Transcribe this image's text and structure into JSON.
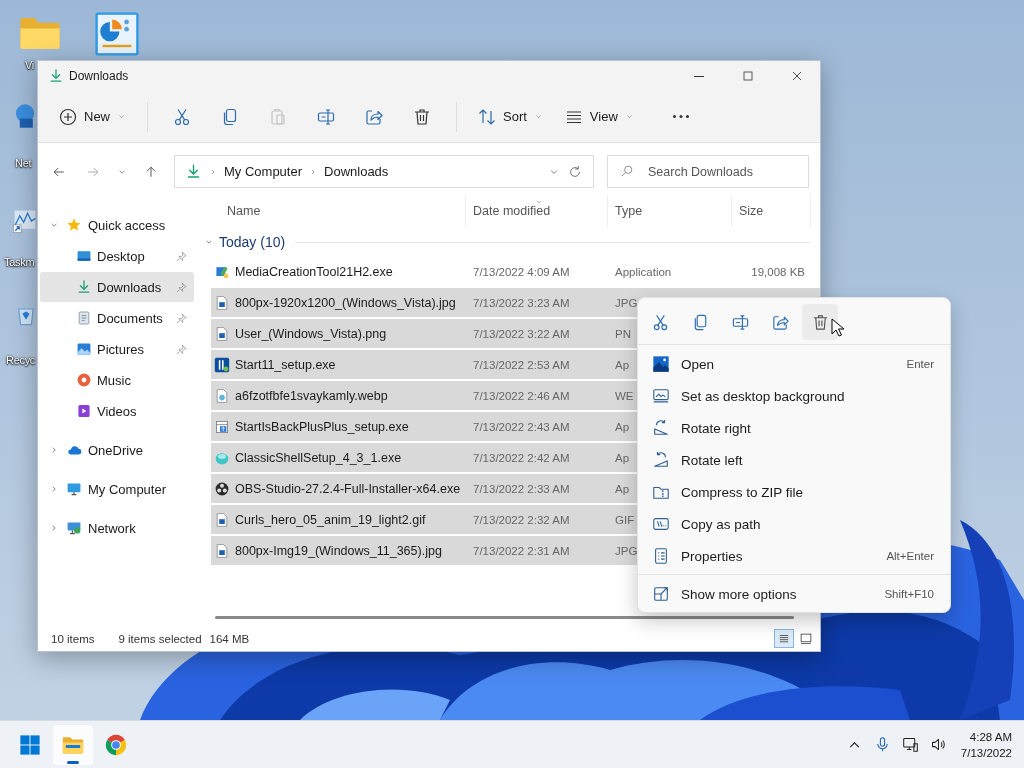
{
  "desktop_icons": [
    {
      "kind": "folder",
      "label": "Vi"
    },
    {
      "kind": "control-panel"
    },
    {
      "kind": "globe",
      "label": "Net"
    },
    {
      "kind": "task-manager",
      "label": "Taskm"
    },
    {
      "kind": "recycle-bin",
      "label": "Recyc"
    }
  ],
  "window": {
    "title": "Downloads"
  },
  "toolbar": [
    {
      "kind": "new",
      "label": "New",
      "disabled": false
    },
    {
      "kind": "cut",
      "disabled": false
    },
    {
      "kind": "copy",
      "disabled": false
    },
    {
      "kind": "paste",
      "disabled": true
    },
    {
      "kind": "rename",
      "disabled": false
    },
    {
      "kind": "share",
      "disabled": false
    },
    {
      "kind": "delete",
      "disabled": false
    },
    {
      "kind": "sort",
      "label": "Sort",
      "disabled": false
    },
    {
      "kind": "view",
      "label": "View",
      "disabled": false
    },
    {
      "kind": "more",
      "disabled": false
    }
  ],
  "address": {
    "path": [
      "My Computer",
      "Downloads"
    ]
  },
  "search": {
    "placeholder": "Search Downloads"
  },
  "sidebar": [
    {
      "label": "Quick access",
      "expanded": true,
      "selected": false,
      "children": [
        {
          "label": "Desktop",
          "pinned": true,
          "selected": false
        },
        {
          "label": "Downloads",
          "pinned": true,
          "selected": true
        },
        {
          "label": "Documents",
          "pinned": true,
          "selected": false
        },
        {
          "label": "Pictures",
          "pinned": true,
          "selected": false
        },
        {
          "label": "Music",
          "pinned": false,
          "selected": false
        },
        {
          "label": "Videos",
          "pinned": false,
          "selected": false
        }
      ]
    },
    {
      "label": "OneDrive",
      "expanded": false,
      "selected": false
    },
    {
      "label": "My Computer",
      "expanded": false,
      "selected": false
    },
    {
      "label": "Network",
      "expanded": false,
      "selected": false
    }
  ],
  "columns": [
    {
      "label": "Name",
      "sorted": false
    },
    {
      "label": "Date modified",
      "sorted": true
    },
    {
      "label": "Type",
      "sorted": false
    },
    {
      "label": "Size",
      "sorted": false
    }
  ],
  "group": {
    "label": "Today (10)",
    "expanded": true
  },
  "rows": [
    {
      "name": "MediaCreationTool21H2.exe",
      "date": "7/13/2022 4:09 AM",
      "type": "Application",
      "size": "19,008 KB",
      "selected": false
    },
    {
      "name": "800px-1920x1200_(Windows_Vista).jpg",
      "date": "7/13/2022 3:23 AM",
      "type": "JPG",
      "selected": true
    },
    {
      "name": "User_(Windows_Vista).png",
      "date": "7/13/2022 3:22 AM",
      "type": "PN",
      "selected": true
    },
    {
      "name": "Start11_setup.exe",
      "date": "7/13/2022 2:53 AM",
      "type": "Ap",
      "selected": true
    },
    {
      "name": "a6fzotfbfe1svaykamly.webp",
      "date": "7/13/2022 2:46 AM",
      "type": "WE",
      "selected": true
    },
    {
      "name": "StartIsBackPlusPlus_setup.exe",
      "date": "7/13/2022 2:43 AM",
      "type": "Ap",
      "selected": true
    },
    {
      "name": "ClassicShellSetup_4_3_1.exe",
      "date": "7/13/2022 2:42 AM",
      "type": "Ap",
      "selected": true
    },
    {
      "name": "OBS-Studio-27.2.4-Full-Installer-x64.exe",
      "date": "7/13/2022 2:33 AM",
      "type": "Ap",
      "selected": true
    },
    {
      "name": "Curls_hero_05_anim_19_light2.gif",
      "date": "7/13/2022 2:32 AM",
      "type": "GIF",
      "selected": true
    },
    {
      "name": "800px-Img19_(Windows_11_365).jpg",
      "date": "7/13/2022 2:31 AM",
      "type": "JPG",
      "selected": true
    }
  ],
  "context_menu": {
    "actions": [
      {
        "kind": "cut",
        "hovered": false
      },
      {
        "kind": "copy",
        "hovered": false
      },
      {
        "kind": "rename",
        "hovered": false
      },
      {
        "kind": "share",
        "hovered": false
      },
      {
        "kind": "delete",
        "hovered": true
      }
    ],
    "items": [
      {
        "label": "Open",
        "shortcut": "Enter"
      },
      {
        "label": "Set as desktop background"
      },
      {
        "label": "Rotate right"
      },
      {
        "label": "Rotate left"
      },
      {
        "label": "Compress to ZIP file"
      },
      {
        "label": "Copy as path"
      },
      {
        "label": "Properties",
        "shortcut": "Alt+Enter"
      }
    ],
    "footer": {
      "label": "Show more options",
      "shortcut": "Shift+F10"
    }
  },
  "status_bar": {
    "count": "10 items",
    "selection": "9 items selected",
    "size": "164 MB",
    "views": [
      {
        "kind": "details",
        "selected": true
      },
      {
        "kind": "tiles",
        "selected": false
      }
    ]
  },
  "taskbar": {
    "apps": [
      {
        "kind": "start",
        "active": false
      },
      {
        "kind": "explorer",
        "active": true
      },
      {
        "kind": "chrome",
        "active": false
      }
    ],
    "tray": [
      {
        "kind": "chevron-up"
      },
      {
        "kind": "microphone"
      },
      {
        "kind": "network"
      },
      {
        "kind": "volume"
      }
    ],
    "time": "4:28 AM",
    "date": "7/13/2022"
  }
}
